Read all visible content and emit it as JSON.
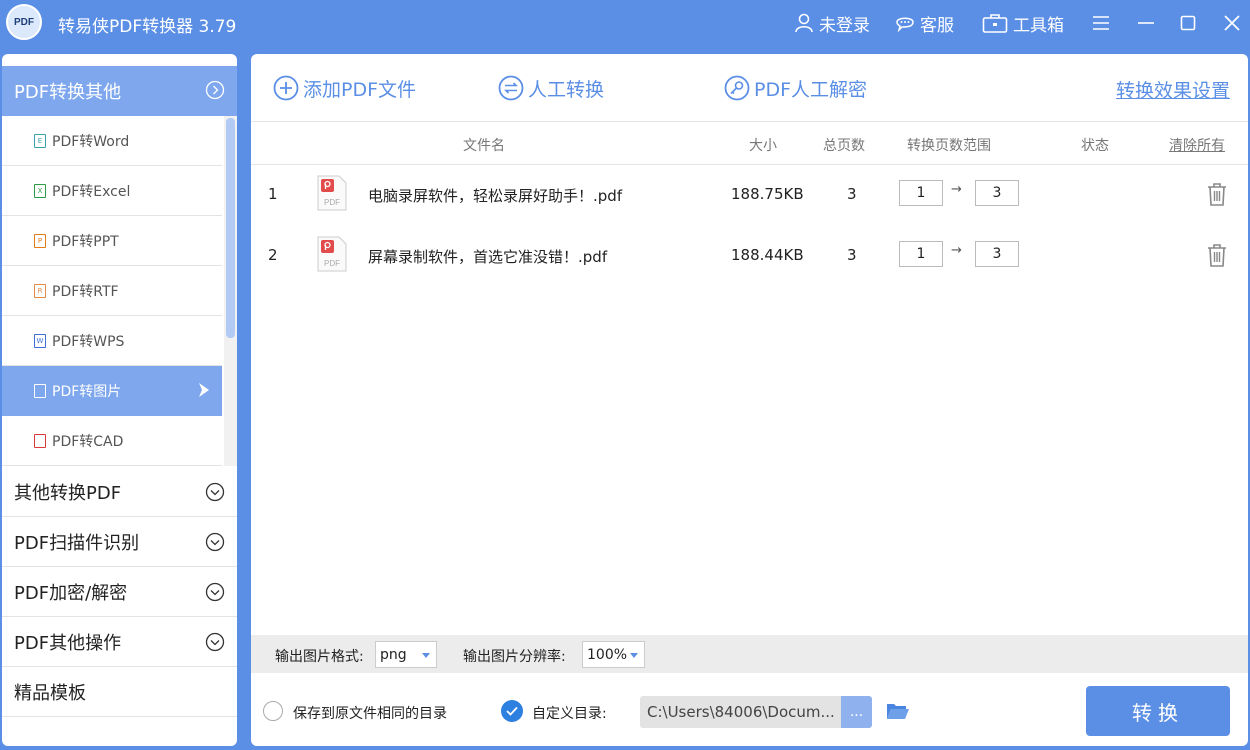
{
  "titlebar": {
    "logo_text": "PDF",
    "title": "转易侠PDF转换器 3.79",
    "user_label": "未登录",
    "service_label": "客服",
    "toolbox_label": "工具箱"
  },
  "sidebar": {
    "header_label": "PDF转换其他",
    "sub_items": [
      {
        "label": "PDF转Word",
        "icon_letter": "E",
        "icon_color": "#3aa0a8"
      },
      {
        "label": "PDF转Excel",
        "icon_letter": "X",
        "icon_color": "#2e9b46"
      },
      {
        "label": "PDF转PPT",
        "icon_letter": "P",
        "icon_color": "#e07b1a"
      },
      {
        "label": "PDF转RTF",
        "icon_letter": "R",
        "icon_color": "#e08a4a"
      },
      {
        "label": "PDF转WPS",
        "icon_letter": "W",
        "icon_color": "#3a6fd8"
      },
      {
        "label": "PDF转图片",
        "icon_letter": "",
        "icon_color": "#ffffff"
      },
      {
        "label": "PDF转CAD",
        "icon_letter": "",
        "icon_color": "#d83a3a"
      }
    ],
    "categories": [
      {
        "label": "其他转换PDF"
      },
      {
        "label": "PDF扫描件识别"
      },
      {
        "label": "PDF加密/解密"
      },
      {
        "label": "PDF其他操作"
      },
      {
        "label": "精品模板"
      }
    ]
  },
  "toolbar": {
    "add_label": "添加PDF文件",
    "manual_label": "人工转换",
    "decrypt_label": "PDF人工解密",
    "settings_label": "转换效果设置"
  },
  "table": {
    "headers": {
      "name": "文件名",
      "size": "大小",
      "pages": "总页数",
      "range": "转换页数范围",
      "status": "状态",
      "clear": "清除所有"
    },
    "rows": [
      {
        "index": "1",
        "file_type": "PDF",
        "name": "电脑录屏软件，轻松录屏好助手！.pdf",
        "size": "188.75KB",
        "pages": "3",
        "from": "1",
        "arrow": "→",
        "to": "3"
      },
      {
        "index": "2",
        "file_type": "PDF",
        "name": "屏幕录制软件，首选它准没错！.pdf",
        "size": "188.44KB",
        "pages": "3",
        "from": "1",
        "arrow": "→",
        "to": "3"
      }
    ]
  },
  "options": {
    "format_label": "输出图片格式:",
    "format_value": "png",
    "resolution_label": "输出图片分辨率:",
    "resolution_value": "100%"
  },
  "bottom": {
    "same_dir_label": "保存到原文件相同的目录",
    "custom_dir_label": "自定义目录:",
    "path_value": "C:\\Users\\84006\\Docum...",
    "browse_label": "...",
    "convert_label": "转换"
  },
  "colors": {
    "accent": "#5b8fe6",
    "active_item": "#7ea7ee",
    "checkbox": "#2d7fe0"
  }
}
